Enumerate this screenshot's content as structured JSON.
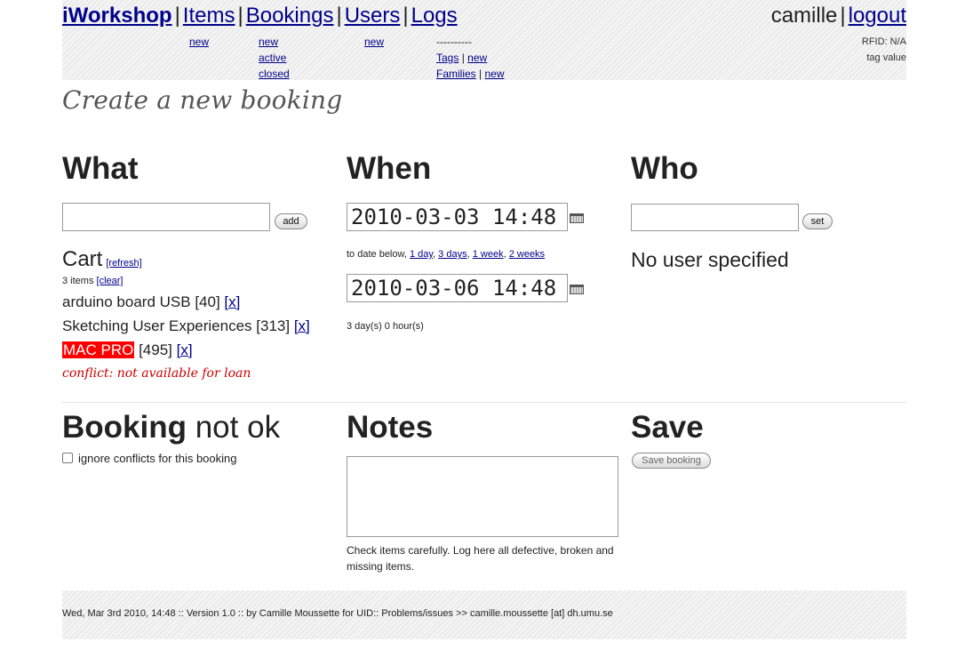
{
  "nav": {
    "brand": "iWorkshop",
    "sep": "|",
    "items": {
      "label": "Items",
      "sub_new": "new"
    },
    "bookings": {
      "label": "Bookings",
      "sub_new": "new",
      "sub_active": "active",
      "sub_closed": "closed"
    },
    "users": {
      "label": "Users",
      "sub_new": "new"
    },
    "logs": {
      "label": "Logs",
      "sub_dashes": "----------",
      "sub_tags": "Tags",
      "sub_tags_new": "new",
      "sub_families": "Families",
      "sub_families_new": "new",
      "pipe": "|"
    }
  },
  "user": {
    "name": "camille",
    "sep": "|",
    "logout": "logout",
    "rfid": "RFID: N/A",
    "tag_value": "tag value"
  },
  "page_title": "Create a new booking",
  "what": {
    "heading": "What",
    "add_button": "add",
    "cart_title": "Cart",
    "refresh": "[refresh]",
    "items_count": "3 items",
    "clear": "[clear]",
    "cart_items": [
      {
        "name": "arduino board USB",
        "id": "[40]",
        "remove": "[x]",
        "highlight": false
      },
      {
        "name": "Sketching User Experiences",
        "id": "[313]",
        "remove": "[x]",
        "highlight": false
      },
      {
        "name": "MAC PRO",
        "id": "[495]",
        "remove": "[x]",
        "highlight": true
      }
    ],
    "conflict": "conflict: not available for loan"
  },
  "when": {
    "heading": "When",
    "from": "2010-03-03 14:48",
    "quick_prefix": "to date below,",
    "quick_links": [
      "1 day",
      "3 days",
      "1 week",
      "2 weeks"
    ],
    "quick_sep": ",",
    "to": "2010-03-06 14:48",
    "duration": "3 day(s) 0 hour(s)"
  },
  "who": {
    "heading": "Who",
    "set_button": "set",
    "no_user": "No user specified"
  },
  "booking_status": {
    "heading_bold": "Booking",
    "heading_light": "not ok",
    "ignore_label": "ignore conflicts for this booking"
  },
  "notes": {
    "heading": "Notes",
    "help": "Check items carefully. Log here all defective, broken and missing items."
  },
  "save": {
    "heading": "Save",
    "button": "Save booking"
  },
  "footer": {
    "text": "Wed, Mar 3rd 2010, 14:48 :: Version 1.0 :: by Camille Moussette for UID:: Problems/issues >> camille.moussette [at] dh.umu.se"
  },
  "colors": {
    "link": "#00008b",
    "conflict_bg": "#ff0000",
    "conflict_text": "#cc0000"
  }
}
